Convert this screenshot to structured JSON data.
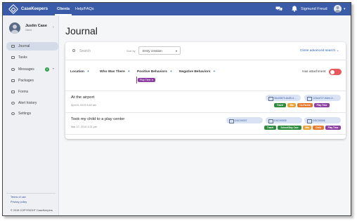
{
  "topbar": {
    "brand": "CaseKeepers",
    "nav": {
      "clients": "Clients",
      "help": "Help/FAQs"
    },
    "user_name": "Sigmund Freud",
    "caret": "▾"
  },
  "sidebar": {
    "client_name": "Justin Case",
    "client_sub": "Client",
    "collapse": "‹",
    "items": [
      {
        "label": "Journal",
        "active": true
      },
      {
        "label": "Tasks"
      },
      {
        "label": "Messages",
        "badge": "0"
      },
      {
        "label": "Packages"
      },
      {
        "label": "Forms"
      },
      {
        "label": "Alert history"
      },
      {
        "label": "Settings"
      }
    ],
    "badge_caret": "▾",
    "footer": {
      "terms": "Terms of use",
      "privacy": "Privacy policy",
      "copyright": "© 2019 COPYRIGHT CaseKeepers"
    }
  },
  "page": {
    "title": "Journal",
    "search_placeholder": "Search",
    "sort_label": "Sort by",
    "sort_value": "Entry creation",
    "sort_caret": "▾",
    "close_advanced": "Close advanced search ⌄",
    "filters": {
      "location": "Location",
      "who": "Who Was There",
      "positive": "Positive Behaviors",
      "negative": "Negative Behaviors",
      "plus": "+"
    },
    "active_chip": "Play Time ✕",
    "attachment_label": "Has attachment",
    "entries": [
      {
        "title": "At the airport",
        "date": "April 8, 2019 8:40 am",
        "files": [
          "06c05870-8c89-4...",
          "123ed727-5dee-4..."
        ],
        "tags": [
          {
            "label": "Travel",
            "color": "#2e8b3e"
          },
          {
            "label": "Mia",
            "color": "#e8a23a"
          },
          {
            "label": "Co-Parent",
            "color": "#e8772e"
          },
          {
            "label": "Play Time",
            "color": "#8c3fa0"
          }
        ]
      },
      {
        "title": "Took my child to a play center",
        "date": "Mar 27, 2019 3:21 pm",
        "files": [
          "DSC00007",
          "DSC00005",
          "DSC00006"
        ],
        "tags": [
          {
            "label": "Travel",
            "color": "#2e8b3e"
          },
          {
            "label": "School/Day Care",
            "color": "#2e8b3e"
          },
          {
            "label": "Mia",
            "color": "#e8a23a"
          },
          {
            "label": "Child",
            "color": "#e8772e"
          },
          {
            "label": "Play Time",
            "color": "#8c3fa0"
          }
        ]
      }
    ]
  }
}
